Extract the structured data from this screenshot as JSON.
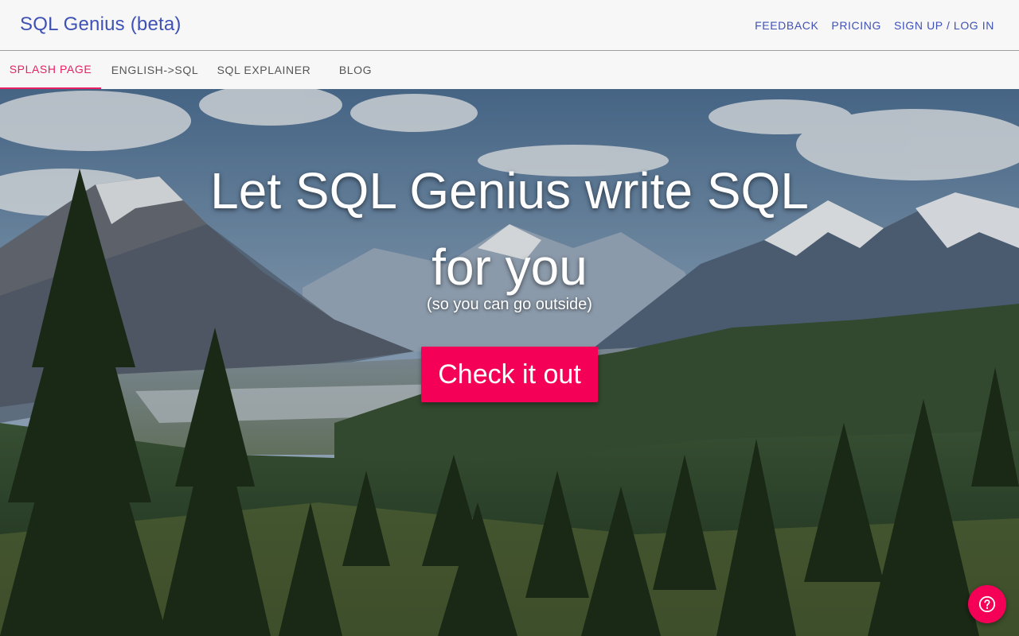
{
  "header": {
    "brand": "SQL Genius (beta)",
    "links": [
      {
        "label": "FEEDBACK"
      },
      {
        "label": "PRICING"
      },
      {
        "label": "SIGN UP / LOG IN"
      }
    ]
  },
  "tabs": [
    {
      "label": "SPLASH PAGE",
      "active": true
    },
    {
      "label": "ENGLISH->SQL",
      "active": false
    },
    {
      "label": "SQL EXPLAINER",
      "active": false
    },
    {
      "label": "BLOG",
      "active": false
    }
  ],
  "hero": {
    "headline_line1": "Let SQL Genius write SQL",
    "headline_line2": "for you",
    "subline": "(so you can go outside)",
    "cta_label": "Check it out",
    "background": "mountains-forest-landscape"
  },
  "help": {
    "icon": "help-circle-icon"
  },
  "colors": {
    "brand": "#3f51b5",
    "accent": "#f50057",
    "active_tab": "#e91e63"
  }
}
